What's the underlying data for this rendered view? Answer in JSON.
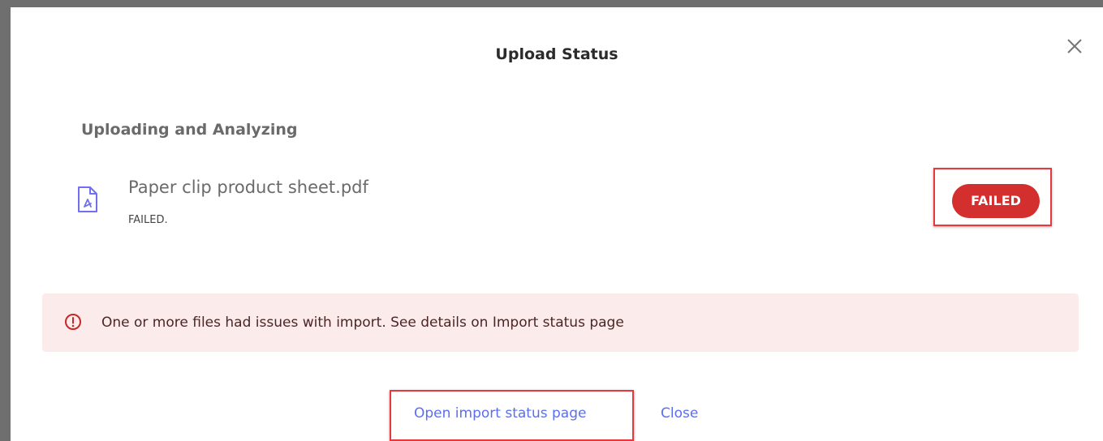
{
  "modal": {
    "title": "Upload Status",
    "close_icon": "close-icon"
  },
  "section": {
    "heading": "Uploading and Analyzing"
  },
  "file": {
    "icon": "pdf-file-icon",
    "name": "Paper clip product sheet.pdf",
    "status_text": "FAILED.",
    "status_badge": "FAILED"
  },
  "alert": {
    "icon": "exclamation-circle-icon",
    "message": "One or more files had issues with import. See details on Import status page"
  },
  "actions": {
    "open_import_status": "Open import status page",
    "close": "Close"
  },
  "colors": {
    "accent_link": "#5a6ef0",
    "failed_badge": "#d32f2f",
    "alert_background": "#fcebeb",
    "highlight_border": "#e8383d"
  }
}
